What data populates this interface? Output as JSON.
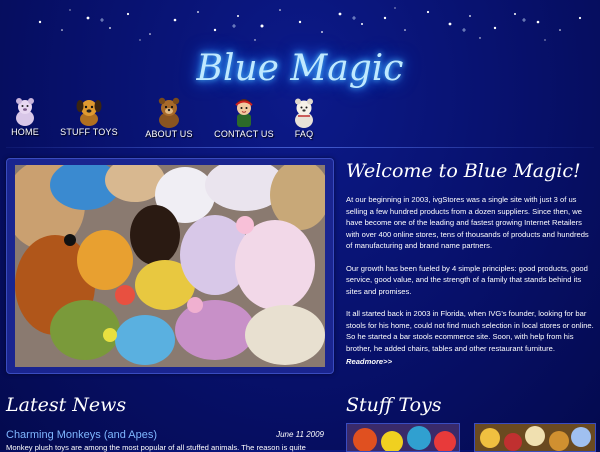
{
  "brand": {
    "logo_text": "Blue Magic"
  },
  "nav": {
    "items": [
      {
        "label": "HOME",
        "icon": "bear-icon-home"
      },
      {
        "label": "STUFF TOYS",
        "icon": "dog-icon"
      },
      {
        "label": "ABOUT US",
        "icon": "bear-icon-brown"
      },
      {
        "label": "CONTACT US",
        "icon": "doll-icon"
      },
      {
        "label": "FAQ",
        "icon": "bear-icon-white"
      }
    ]
  },
  "welcome": {
    "title": "Welcome to Blue Magic!",
    "p1": "At our beginning in 2003, ivgStores was a single site with just 3 of us selling a few hundred products from a dozen suppliers. Since then, we have become one of the leading and fastest growing Internet Retailers with over 400 online stores, tens of thousands of products and hundreds of manufacturing and brand name partners.",
    "p2": "Our growth has been fueled by 4 simple principles: good products, good service, good value, and the strength of a family that stands behind its sites and promises.",
    "p3": "It all started back in 2003 in Florida, when IVG's founder, looking for bar stools for his home, could not find much selection in local stores or online. So he started a bar stools ecommerce site. Soon, with help from his brother, he added chairs, tables and other restaurant furniture.",
    "readmore": "Readmore>>"
  },
  "news": {
    "title": "Latest News",
    "items": [
      {
        "headline": "Charming Monkeys (and Apes)",
        "date": "June 11 2009",
        "body": "Monkey plush toys are among the most popular of all stuffed animals. The reason is quite"
      }
    ]
  },
  "toys": {
    "title": "Stuff Toys"
  },
  "colors": {
    "background": "#07106a",
    "glow": "#4fc3ff",
    "link": "#7fb6ff"
  }
}
